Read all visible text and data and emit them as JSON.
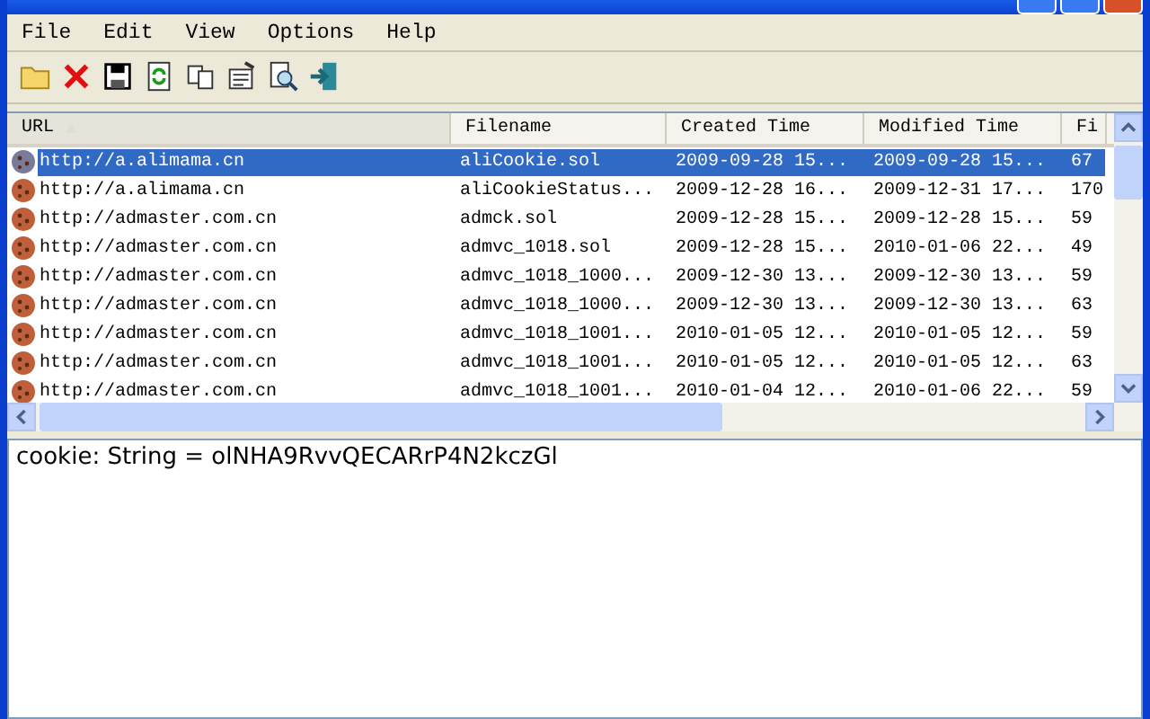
{
  "menu": [
    "File",
    "Edit",
    "View",
    "Options",
    "Help"
  ],
  "table": {
    "columns": [
      {
        "label": "URL",
        "sorted": true
      },
      {
        "label": "Filename",
        "sorted": false
      },
      {
        "label": "Created Time",
        "sorted": false
      },
      {
        "label": "Modified Time",
        "sorted": false
      },
      {
        "label": "Fi",
        "sorted": false
      }
    ],
    "rows": [
      {
        "selected": true,
        "cells": [
          "http://a.alimama.cn",
          "aliCookie.sol",
          "2009-09-28 15...",
          "2009-09-28 15...",
          "67"
        ]
      },
      {
        "selected": false,
        "cells": [
          "http://a.alimama.cn",
          "aliCookieStatus...",
          "2009-12-28 16...",
          "2009-12-31 17...",
          "170"
        ]
      },
      {
        "selected": false,
        "cells": [
          "http://admaster.com.cn",
          "admck.sol",
          "2009-12-28 15...",
          "2009-12-28 15...",
          "59"
        ]
      },
      {
        "selected": false,
        "cells": [
          "http://admaster.com.cn",
          "admvc_1018.sol",
          "2009-12-28 15...",
          "2010-01-06 22...",
          "49"
        ]
      },
      {
        "selected": false,
        "cells": [
          "http://admaster.com.cn",
          "admvc_1018_1000...",
          "2009-12-30 13...",
          "2009-12-30 13...",
          "59"
        ]
      },
      {
        "selected": false,
        "cells": [
          "http://admaster.com.cn",
          "admvc_1018_1000...",
          "2009-12-30 13...",
          "2009-12-30 13...",
          "63"
        ]
      },
      {
        "selected": false,
        "cells": [
          "http://admaster.com.cn",
          "admvc_1018_1001...",
          "2010-01-05 12...",
          "2010-01-05 12...",
          "59"
        ]
      },
      {
        "selected": false,
        "cells": [
          "http://admaster.com.cn",
          "admvc_1018_1001...",
          "2010-01-05 12...",
          "2010-01-05 12...",
          "63"
        ]
      },
      {
        "selected": false,
        "cells": [
          "http://admaster.com.cn",
          "admvc_1018_1001...",
          "2010-01-04 12...",
          "2010-01-06 22...",
          "59"
        ]
      }
    ]
  },
  "detail": {
    "text": "cookie: String = olNHA9RvvQECARrP4N2kczGl"
  }
}
